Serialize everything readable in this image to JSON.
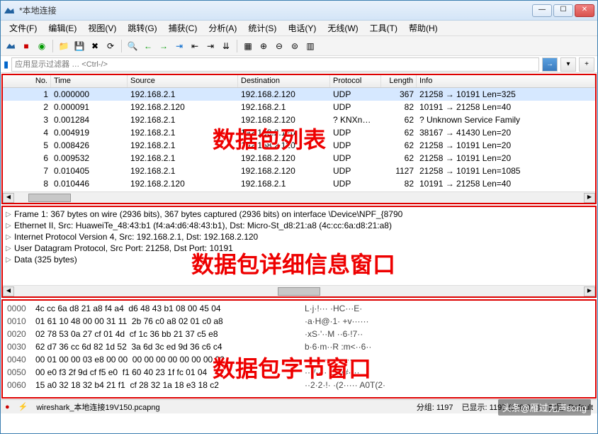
{
  "title": "*本地连接",
  "menu": [
    "文件(F)",
    "编辑(E)",
    "视图(V)",
    "跳转(G)",
    "捕获(C)",
    "分析(A)",
    "统计(S)",
    "电话(Y)",
    "无线(W)",
    "工具(T)",
    "帮助(H)"
  ],
  "filter_placeholder": "应用显示过滤器 … <Ctrl-/>",
  "columns": {
    "no": "No.",
    "time": "Time",
    "source": "Source",
    "destination": "Destination",
    "protocol": "Protocol",
    "length": "Length",
    "info": "Info"
  },
  "packets": [
    {
      "no": "1",
      "time": "0.000000",
      "src": "192.168.2.1",
      "dst": "192.168.2.120",
      "proto": "UDP",
      "len": "367",
      "info": "21258 → 10191 Len=325"
    },
    {
      "no": "2",
      "time": "0.000091",
      "src": "192.168.2.120",
      "dst": "192.168.2.1",
      "proto": "UDP",
      "len": "82",
      "info": "10191 → 21258 Len=40"
    },
    {
      "no": "3",
      "time": "0.001284",
      "src": "192.168.2.1",
      "dst": "192.168.2.120",
      "proto": "? KNXn…",
      "len": "62",
      "info": "? Unknown Service Family"
    },
    {
      "no": "4",
      "time": "0.004919",
      "src": "192.168.2.1",
      "dst": "192.168.2.120",
      "proto": "UDP",
      "len": "62",
      "info": "38167 → 41430 Len=20"
    },
    {
      "no": "5",
      "time": "0.008426",
      "src": "192.168.2.1",
      "dst": "192.168.2.120",
      "proto": "UDP",
      "len": "62",
      "info": "21258 → 10191 Len=20"
    },
    {
      "no": "6",
      "time": "0.009532",
      "src": "192.168.2.1",
      "dst": "192.168.2.120",
      "proto": "UDP",
      "len": "62",
      "info": "21258 → 10191 Len=20"
    },
    {
      "no": "7",
      "time": "0.010405",
      "src": "192.168.2.1",
      "dst": "192.168.2.120",
      "proto": "UDP",
      "len": "1127",
      "info": "21258 → 10191 Len=1085"
    },
    {
      "no": "8",
      "time": "0.010446",
      "src": "192.168.2.120",
      "dst": "192.168.2.1",
      "proto": "UDP",
      "len": "82",
      "info": "10191 → 21258 Len=40"
    }
  ],
  "details": [
    "Frame 1: 367 bytes on wire (2936 bits), 367 bytes captured (2936 bits) on interface \\Device\\NPF_{8790",
    "Ethernet II, Src: HuaweiTe_48:43:b1 (f4:a4:d6:48:43:b1), Dst: Micro-St_d8:21:a8 (4c:cc:6a:d8:21:a8)",
    "Internet Protocol Version 4, Src: 192.168.2.1, Dst: 192.168.2.120",
    "User Datagram Protocol, Src Port: 21258, Dst Port: 10191",
    "Data (325 bytes)"
  ],
  "hex": [
    {
      "off": "0000",
      "b": "4c cc 6a d8 21 a8 f4 a4  d6 48 43 b1 08 00 45 04",
      "a": "L·j·!··· ·HC···E·"
    },
    {
      "off": "0010",
      "b": "01 61 10 48 00 00 31 11  2b 76 c0 a8 02 01 c0 a8",
      "a": "·a·H@·1· +v······"
    },
    {
      "off": "0020",
      "b": "02 78 53 0a 27 cf 01 4d  cf 1c 36 bb 21 37 c5 e8",
      "a": "·xS·'··M ··6·!7··"
    },
    {
      "off": "0030",
      "b": "62 d7 36 cc 6d 82 1d 52  3a 6d 3c ed 9d 36 c6 c4",
      "a": "b·6·m··R :m<··6··"
    },
    {
      "off": "0040",
      "b": "00 01 00 00 03 e8 00 00  00 00 00 00 00 00 00 00",
      "a": "········ ········"
    },
    {
      "off": "0050",
      "b": "00 e0 f3 2f 9d cf f5 e0  f1 60 40 23 1f fc 01 04",
      "a": "···/···· ·`@#····"
    },
    {
      "off": "0060",
      "b": "15 a0 32 18 32 b4 21 f1  cf 28 32 1a 18 e3 18 c2",
      "a": "··2·2·!· ·(2····· A0T(2·"
    }
  ],
  "status": {
    "file": "wireshark_本地连接19V150.pcapng",
    "pkts": "分组: 1197",
    "disp": "已显示: 1197 (100.0%)",
    "profile": "配置: Default"
  },
  "overlays": {
    "list": "数据包列表",
    "detail": "数据包详细信息窗口",
    "hex": "数据包字节窗口"
  },
  "watermark": "头条@雁过无声song"
}
